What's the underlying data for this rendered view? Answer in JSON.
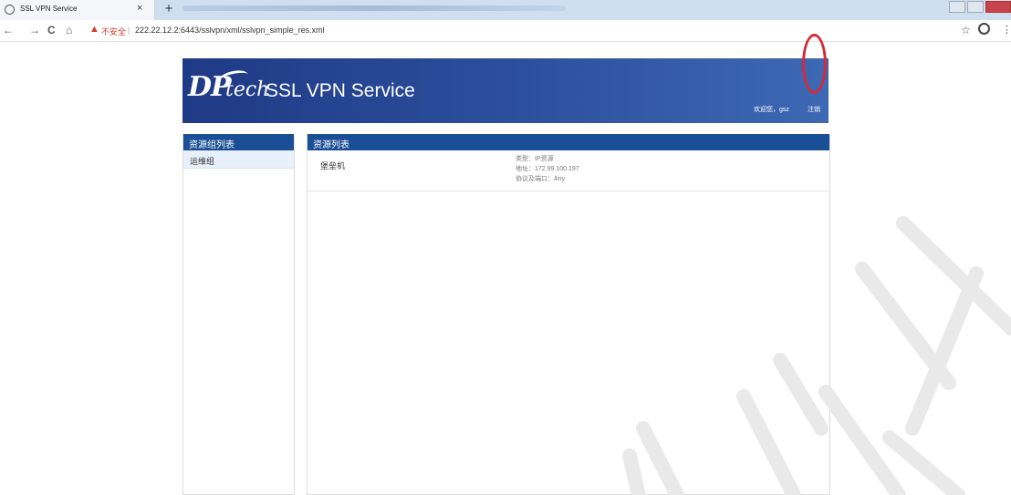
{
  "browser": {
    "tab_title": "SSL VPN Service",
    "tab_close": "×",
    "new_tab": "+",
    "nav": {
      "back": "←",
      "forward": "→",
      "reload": "C",
      "home": "⌂"
    },
    "security_warning": "不安全",
    "url": "222.22.12.2:6443/sslvpn/xml/sslvpn_simple_res.xml",
    "separator": "|",
    "bookmark": "☆",
    "menu": "⋮"
  },
  "header": {
    "logo_dp": "DP",
    "logo_tech": "tech",
    "brand": "SSL VPN Service",
    "welcome": "欢迎您，gsz",
    "logout": "注销"
  },
  "left_panel": {
    "title": "资源组列表",
    "groups": [
      "运维组"
    ]
  },
  "right_panel": {
    "title": "资源列表",
    "resources": [
      {
        "name": "堡垒机",
        "type": "类型：IP资源",
        "address": "地址：172.99.100.197",
        "protocol": "协议及端口：Any"
      }
    ]
  },
  "colors": {
    "header_start": "#1f3a86",
    "header_end": "#3d68b4",
    "panel_header": "#1b4f95",
    "annotation": "#d32b38",
    "warning": "#d23a2a"
  }
}
